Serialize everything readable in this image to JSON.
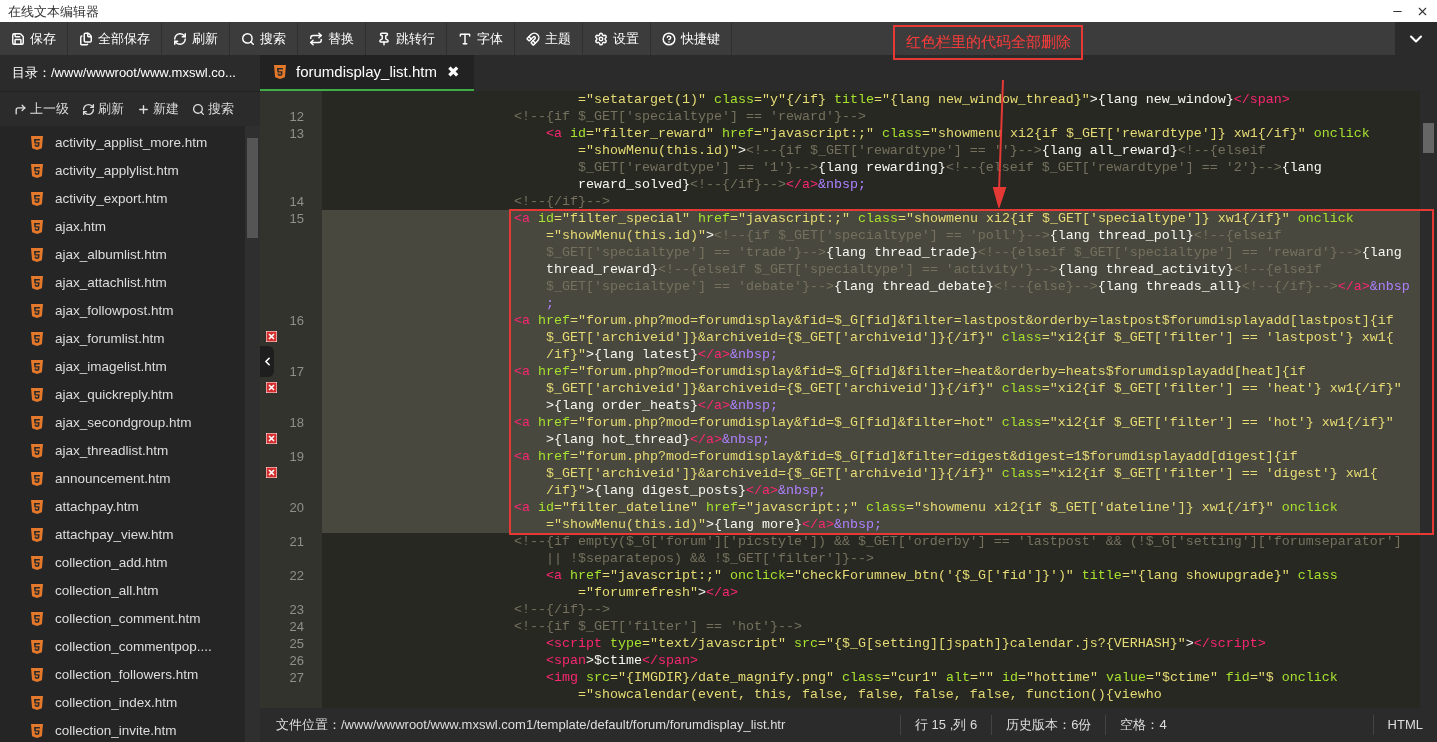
{
  "window": {
    "title": "在线文本编辑器"
  },
  "toolbar": [
    {
      "kind": "save",
      "label": "保存"
    },
    {
      "kind": "save-all",
      "label": "全部保存"
    },
    {
      "kind": "refresh",
      "label": "刷新"
    },
    {
      "kind": "search",
      "label": "搜索"
    },
    {
      "kind": "replace",
      "label": "替换"
    },
    {
      "kind": "goto",
      "label": "跳转行"
    },
    {
      "kind": "font",
      "label": "字体"
    },
    {
      "kind": "theme",
      "label": "主题"
    },
    {
      "kind": "settings",
      "label": "设置"
    },
    {
      "kind": "shortcuts",
      "label": "快捷键"
    }
  ],
  "sidebar": {
    "path": "目录：/www/wwwroot/www.mxswl.co...",
    "actions": [
      {
        "kind": "up",
        "label": "上一级"
      },
      {
        "kind": "refresh",
        "label": "刷新"
      },
      {
        "kind": "new",
        "label": "新建"
      },
      {
        "kind": "search",
        "label": "搜索"
      }
    ],
    "files": [
      "activity_applist_more.htm",
      "activity_applylist.htm",
      "activity_export.htm",
      "ajax.htm",
      "ajax_albumlist.htm",
      "ajax_attachlist.htm",
      "ajax_followpost.htm",
      "ajax_forumlist.htm",
      "ajax_imagelist.htm",
      "ajax_quickreply.htm",
      "ajax_secondgroup.htm",
      "ajax_threadlist.htm",
      "announcement.htm",
      "attachpay.htm",
      "attachpay_view.htm",
      "collection_add.htm",
      "collection_all.htm",
      "collection_comment.htm",
      "collection_commentpop....",
      "collection_followers.htm",
      "collection_index.htm",
      "collection_invite.htm"
    ]
  },
  "tabs": [
    {
      "label": "forumdisplay_list.htm",
      "close": "✖",
      "selected": true
    }
  ],
  "code": {
    "lines": [
      {
        "selected": false,
        "error": false,
        "rows": [
          {
            "tokens": [
              {
                "kind": "str",
                "text": "                                =\"setatarget(1)\""
              },
              {
                "kind": "attr",
                "text": " class"
              },
              {
                "kind": "str",
                "text": "=\"y\"{/if}"
              },
              {
                "kind": "attr",
                "text": " title"
              },
              {
                "kind": "str",
                "text": "=\"{lang new_window_thread}\""
              },
              {
                "kind": "text",
                "text": ">{lang new_window}"
              },
              {
                "kind": "tag",
                "text": "</span>"
              }
            ]
          }
        ]
      },
      {
        "number": "12",
        "selected": false,
        "error": false,
        "rows": [
          {
            "tokens": [
              {
                "kind": "comment",
                "text": "                        <!--{if $_GET['specialtype'] == 'reward'}-->"
              }
            ]
          }
        ]
      },
      {
        "number": "13",
        "selected": false,
        "error": false,
        "rows": [
          {
            "tokens": [
              {
                "kind": "tag",
                "text": "                            <a"
              },
              {
                "kind": "attr",
                "text": " id"
              },
              {
                "kind": "str",
                "text": "=\"filter_reward\""
              },
              {
                "kind": "attr",
                "text": " href"
              },
              {
                "kind": "str",
                "text": "=\"javascript:;\""
              },
              {
                "kind": "attr",
                "text": " class"
              },
              {
                "kind": "str",
                "text": "=\"showmenu xi2{if $_GET['rewardtype']} xw1{/if}\""
              },
              {
                "kind": "attr",
                "text": " onclick"
              }
            ]
          },
          {
            "tokens": [
              {
                "kind": "str",
                "text": "                                =\"showMenu(this.id)\""
              },
              {
                "kind": "text",
                "text": ">"
              },
              {
                "kind": "comment",
                "text": "<!--{if $_GET['rewardtype'] == ''}-->"
              },
              {
                "kind": "text",
                "text": "{lang all_reward}"
              },
              {
                "kind": "comment",
                "text": "<!--{elseif"
              }
            ]
          },
          {
            "tokens": [
              {
                "kind": "comment",
                "text": "                                $_GET['rewardtype'] == '1'}-->"
              },
              {
                "kind": "text",
                "text": "{lang rewarding}"
              },
              {
                "kind": "comment",
                "text": "<!--{elseif $_GET['rewardtype'] == '2'}-->"
              },
              {
                "kind": "text",
                "text": "{lang"
              }
            ]
          },
          {
            "tokens": [
              {
                "kind": "text",
                "text": "                                reward_solved}"
              },
              {
                "kind": "comment",
                "text": "<!--{/if}-->"
              },
              {
                "kind": "tag",
                "text": "</a>"
              },
              {
                "kind": "ent",
                "text": "&nbsp;"
              }
            ]
          }
        ]
      },
      {
        "number": "14",
        "selected": false,
        "error": false,
        "rows": [
          {
            "tokens": [
              {
                "kind": "comment",
                "text": "                        <!--{/if}-->"
              }
            ]
          }
        ]
      },
      {
        "number": "15",
        "selected": true,
        "error": false,
        "rows": [
          {
            "tokens": [
              {
                "kind": "tag",
                "text": "                        <a"
              },
              {
                "kind": "attr",
                "text": " id"
              },
              {
                "kind": "str",
                "text": "=\"filter_special\""
              },
              {
                "kind": "attr",
                "text": " href"
              },
              {
                "kind": "str",
                "text": "=\"javascript:;\""
              },
              {
                "kind": "attr",
                "text": " class"
              },
              {
                "kind": "str",
                "text": "=\"showmenu xi2{if $_GET['specialtype']} xw1{/if}\""
              },
              {
                "kind": "attr",
                "text": " onclick"
              }
            ]
          },
          {
            "tokens": [
              {
                "kind": "str",
                "text": "                            =\"showMenu(this.id)\""
              },
              {
                "kind": "text",
                "text": ">"
              },
              {
                "kind": "comment",
                "text": "<!--{if $_GET['specialtype'] == 'poll'}-->"
              },
              {
                "kind": "text",
                "text": "{lang thread_poll}"
              },
              {
                "kind": "comment",
                "text": "<!--{elseif"
              }
            ]
          },
          {
            "tokens": [
              {
                "kind": "comment",
                "text": "                            $_GET['specialtype'] == 'trade'}-->"
              },
              {
                "kind": "text",
                "text": "{lang thread_trade}"
              },
              {
                "kind": "comment",
                "text": "<!--{elseif $_GET['specialtype'] == 'reward'}-->"
              },
              {
                "kind": "text",
                "text": "{lang"
              }
            ]
          },
          {
            "tokens": [
              {
                "kind": "text",
                "text": "                            thread_reward}"
              },
              {
                "kind": "comment",
                "text": "<!--{elseif $_GET['specialtype'] == 'activity'}-->"
              },
              {
                "kind": "text",
                "text": "{lang thread_activity}"
              },
              {
                "kind": "comment",
                "text": "<!--{elseif"
              }
            ]
          },
          {
            "tokens": [
              {
                "kind": "comment",
                "text": "                            $_GET['specialtype'] == 'debate'}-->"
              },
              {
                "kind": "text",
                "text": "{lang thread_debate}"
              },
              {
                "kind": "comment",
                "text": "<!--{else}-->"
              },
              {
                "kind": "text",
                "text": "{lang threads_all}"
              },
              {
                "kind": "comment",
                "text": "<!--{/if}-->"
              },
              {
                "kind": "tag",
                "text": "</a>"
              },
              {
                "kind": "ent",
                "text": "&nbsp"
              }
            ]
          },
          {
            "tokens": [
              {
                "kind": "ent",
                "text": "                            ;"
              }
            ]
          }
        ]
      },
      {
        "number": "16",
        "selected": true,
        "error": true,
        "rows": [
          {
            "tokens": [
              {
                "kind": "tag",
                "text": "                        <a"
              },
              {
                "kind": "attr",
                "text": " href"
              },
              {
                "kind": "str",
                "text": "=\"forum.php?mod=forumdisplay&fid=$_G[fid]&filter=lastpost&orderby=lastpost$forumdisplayadd[lastpost]{if"
              }
            ]
          },
          {
            "tokens": [
              {
                "kind": "str",
                "text": "                            $_GET['archiveid']}&archiveid={$_GET['archiveid']}{/if}\""
              },
              {
                "kind": "attr",
                "text": " class"
              },
              {
                "kind": "str",
                "text": "=\"xi2{if $_GET['filter'] == 'lastpost'} xw1{"
              }
            ]
          },
          {
            "tokens": [
              {
                "kind": "str",
                "text": "                            /if}\""
              },
              {
                "kind": "text",
                "text": ">{lang latest}"
              },
              {
                "kind": "tag",
                "text": "</a>"
              },
              {
                "kind": "ent",
                "text": "&nbsp;"
              }
            ]
          }
        ]
      },
      {
        "number": "17",
        "selected": true,
        "error": true,
        "rows": [
          {
            "tokens": [
              {
                "kind": "tag",
                "text": "                        <a"
              },
              {
                "kind": "attr",
                "text": " href"
              },
              {
                "kind": "str",
                "text": "=\"forum.php?mod=forumdisplay&fid=$_G[fid]&filter=heat&orderby=heats$forumdisplayadd[heat]{if"
              }
            ]
          },
          {
            "tokens": [
              {
                "kind": "str",
                "text": "                            $_GET['archiveid']}&archiveid={$_GET['archiveid']}{/if}\""
              },
              {
                "kind": "attr",
                "text": " class"
              },
              {
                "kind": "str",
                "text": "=\"xi2{if $_GET['filter'] == 'heat'} xw1{/if}\""
              }
            ]
          },
          {
            "tokens": [
              {
                "kind": "text",
                "text": "                            >{lang order_heats}"
              },
              {
                "kind": "tag",
                "text": "</a>"
              },
              {
                "kind": "ent",
                "text": "&nbsp;"
              }
            ]
          }
        ]
      },
      {
        "number": "18",
        "selected": true,
        "error": true,
        "rows": [
          {
            "tokens": [
              {
                "kind": "tag",
                "text": "                        <a"
              },
              {
                "kind": "attr",
                "text": " href"
              },
              {
                "kind": "str",
                "text": "=\"forum.php?mod=forumdisplay&fid=$_G[fid]&filter=hot\""
              },
              {
                "kind": "attr",
                "text": " class"
              },
              {
                "kind": "str",
                "text": "=\"xi2{if $_GET['filter'] == 'hot'} xw1{/if}\""
              }
            ]
          },
          {
            "tokens": [
              {
                "kind": "text",
                "text": "                            >{lang hot_thread}"
              },
              {
                "kind": "tag",
                "text": "</a>"
              },
              {
                "kind": "ent",
                "text": "&nbsp;"
              }
            ]
          }
        ]
      },
      {
        "number": "19",
        "selected": true,
        "error": true,
        "rows": [
          {
            "tokens": [
              {
                "kind": "tag",
                "text": "                        <a"
              },
              {
                "kind": "attr",
                "text": " href"
              },
              {
                "kind": "str",
                "text": "=\"forum.php?mod=forumdisplay&fid=$_G[fid]&filter=digest&digest=1$forumdisplayadd[digest]{if"
              }
            ]
          },
          {
            "tokens": [
              {
                "kind": "str",
                "text": "                            $_GET['archiveid']}&archiveid={$_GET['archiveid']}{/if}\""
              },
              {
                "kind": "attr",
                "text": " class"
              },
              {
                "kind": "str",
                "text": "=\"xi2{if $_GET['filter'] == 'digest'} xw1{"
              }
            ]
          },
          {
            "tokens": [
              {
                "kind": "str",
                "text": "                            /if}\""
              },
              {
                "kind": "text",
                "text": ">{lang digest_posts}"
              },
              {
                "kind": "tag",
                "text": "</a>"
              },
              {
                "kind": "ent",
                "text": "&nbsp;"
              }
            ]
          }
        ]
      },
      {
        "number": "20",
        "selected": true,
        "error": false,
        "rows": [
          {
            "tokens": [
              {
                "kind": "tag",
                "text": "                        <a"
              },
              {
                "kind": "attr",
                "text": " id"
              },
              {
                "kind": "str",
                "text": "=\"filter_dateline\""
              },
              {
                "kind": "attr",
                "text": " href"
              },
              {
                "kind": "str",
                "text": "=\"javascript:;\""
              },
              {
                "kind": "attr",
                "text": " class"
              },
              {
                "kind": "str",
                "text": "=\"showmenu xi2{if $_GET['dateline']} xw1{/if}\""
              },
              {
                "kind": "attr",
                "text": " onclick"
              }
            ]
          },
          {
            "tokens": [
              {
                "kind": "str",
                "text": "                            =\"showMenu(this.id)\""
              },
              {
                "kind": "text",
                "text": ">{lang more}"
              },
              {
                "kind": "tag",
                "text": "</a>"
              },
              {
                "kind": "ent",
                "text": "&nbsp;"
              }
            ]
          }
        ]
      },
      {
        "number": "21",
        "selected": false,
        "error": false,
        "rows": [
          {
            "tokens": [
              {
                "kind": "comment",
                "text": "                        <!--{if empty($_G['forum']['picstyle']) && $_GET['orderby'] == 'lastpost' && (!$_G['setting']['forumseparator']"
              }
            ]
          },
          {
            "tokens": [
              {
                "kind": "comment",
                "text": "                            || !$separatepos) && !$_GET['filter']}-->"
              }
            ]
          }
        ]
      },
      {
        "number": "22",
        "selected": false,
        "error": false,
        "rows": [
          {
            "tokens": [
              {
                "kind": "tag",
                "text": "                            <a"
              },
              {
                "kind": "attr",
                "text": " href"
              },
              {
                "kind": "str",
                "text": "=\"javascript:;\""
              },
              {
                "kind": "attr",
                "text": " onclick"
              },
              {
                "kind": "str",
                "text": "=\"checkForumnew_btn('{$_G['fid']}')\""
              },
              {
                "kind": "attr",
                "text": " title"
              },
              {
                "kind": "str",
                "text": "=\"{lang showupgrade}\""
              },
              {
                "kind": "attr",
                "text": " class"
              }
            ]
          },
          {
            "tokens": [
              {
                "kind": "str",
                "text": "                                =\"forumrefresh\""
              },
              {
                "kind": "text",
                "text": ">"
              },
              {
                "kind": "tag",
                "text": "</a>"
              }
            ]
          }
        ]
      },
      {
        "number": "23",
        "selected": false,
        "error": false,
        "rows": [
          {
            "tokens": [
              {
                "kind": "comment",
                "text": "                        <!--{/if}-->"
              }
            ]
          }
        ]
      },
      {
        "number": "24",
        "selected": false,
        "error": false,
        "rows": [
          {
            "tokens": [
              {
                "kind": "comment",
                "text": "                        <!--{if $_GET['filter'] == 'hot'}-->"
              }
            ]
          }
        ]
      },
      {
        "number": "25",
        "selected": false,
        "error": false,
        "rows": [
          {
            "tokens": [
              {
                "kind": "tag",
                "text": "                            <script"
              },
              {
                "kind": "attr",
                "text": " type"
              },
              {
                "kind": "str",
                "text": "=\"text/javascript\""
              },
              {
                "kind": "attr",
                "text": " src"
              },
              {
                "kind": "str",
                "text": "=\"{$_G[setting][jspath]}calendar.js?{VERHASH}\""
              },
              {
                "kind": "text",
                "text": ">"
              },
              {
                "kind": "tag",
                "text": "</script>"
              }
            ]
          }
        ]
      },
      {
        "number": "26",
        "selected": false,
        "error": false,
        "rows": [
          {
            "tokens": [
              {
                "kind": "tag",
                "text": "                            <span"
              },
              {
                "kind": "text",
                "text": ">$ctime"
              },
              {
                "kind": "tag",
                "text": "</span>"
              }
            ]
          }
        ]
      },
      {
        "number": "27",
        "selected": false,
        "error": false,
        "rows": [
          {
            "tokens": [
              {
                "kind": "tag",
                "text": "                            <img"
              },
              {
                "kind": "attr",
                "text": " src"
              },
              {
                "kind": "str",
                "text": "=\"{IMGDIR}/date_magnify.png\""
              },
              {
                "kind": "attr",
                "text": " class"
              },
              {
                "kind": "str",
                "text": "=\"cur1\""
              },
              {
                "kind": "attr",
                "text": " alt"
              },
              {
                "kind": "str",
                "text": "=\"\""
              },
              {
                "kind": "attr",
                "text": " id"
              },
              {
                "kind": "str",
                "text": "=\"hottime\""
              },
              {
                "kind": "attr",
                "text": " value"
              },
              {
                "kind": "str",
                "text": "=\"$ctime\""
              },
              {
                "kind": "attr",
                "text": " fid"
              },
              {
                "kind": "str",
                "text": "=\"$"
              },
              {
                "kind": "attr",
                "text": " onclick"
              }
            ]
          },
          {
            "tokens": [
              {
                "kind": "str",
                "text": "                                =\"showcalendar(event, this, false, false, false, false, function(){viewho"
              }
            ]
          }
        ]
      }
    ]
  },
  "annotation": {
    "note": "红色栏里的代码全部删除"
  },
  "status_bar": {
    "file": "文件位置：/www/wwwroot/www.mxswl.com1/template/default/forum/forumdisplay_list.htr",
    "position": "行 15 ,列 6",
    "history": "历史版本：6份",
    "indent": "空格：4",
    "mode": "HTML"
  }
}
